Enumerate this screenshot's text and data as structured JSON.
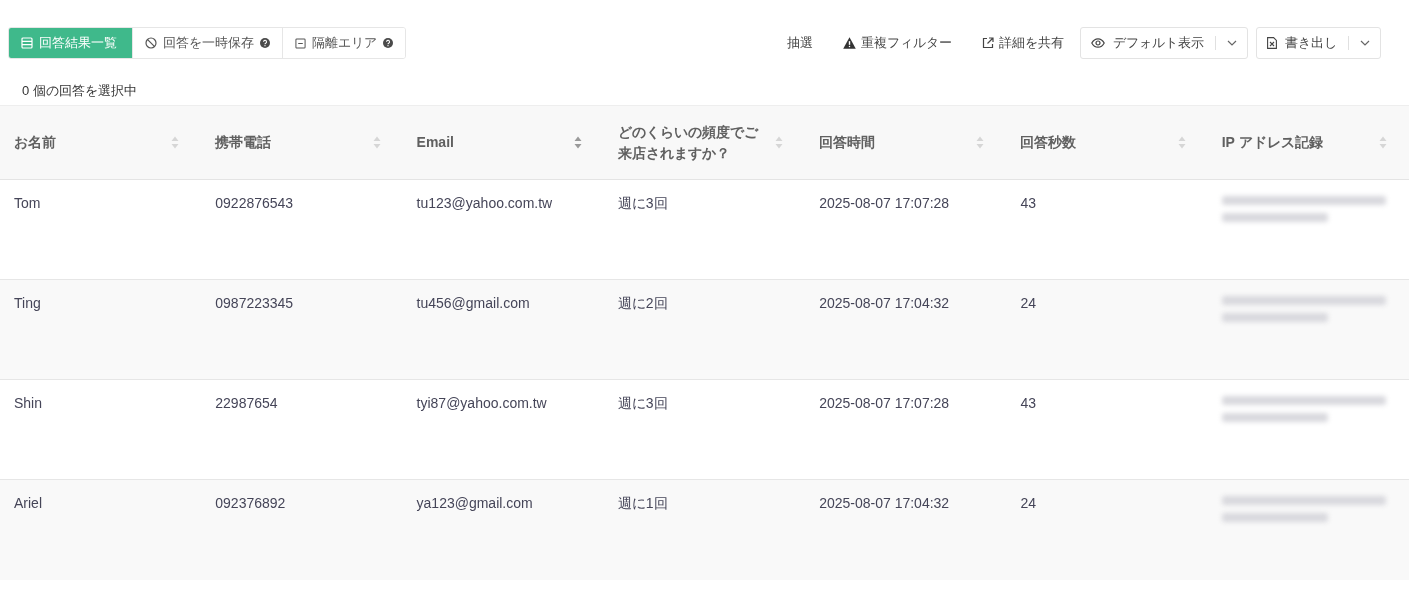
{
  "tabs": [
    {
      "label": "回答結果一覧",
      "selected": true
    },
    {
      "label": "回答を一時保存",
      "selected": false
    },
    {
      "label": "隔離エリア",
      "selected": false
    }
  ],
  "actions": [
    {
      "kind": "link",
      "label": "抽選"
    },
    {
      "kind": "link",
      "label": "重複フィルター"
    },
    {
      "kind": "link",
      "label": "詳細を共有"
    },
    {
      "kind": "dropdown",
      "label": "デフォルト表示"
    },
    {
      "kind": "dropdown",
      "label": "書き出し"
    }
  ],
  "selection_status": "0 個の回答を選択中",
  "table": {
    "columns": [
      {
        "label": "お名前",
        "sort_active": false
      },
      {
        "label": "携帯電話",
        "sort_active": false
      },
      {
        "label": "Email",
        "sort_active": true
      },
      {
        "label": "どのくらいの頻度でご来店されますか？",
        "sort_active": false
      },
      {
        "label": "回答時間",
        "sort_active": false
      },
      {
        "label": "回答秒数",
        "sort_active": false
      },
      {
        "label": "IP アドレス記録",
        "sort_active": false
      }
    ],
    "rows": [
      {
        "cells": [
          "Tom",
          "0922876543",
          "tu123@yahoo.com.tw",
          "週に3回",
          "2025-08-07 17:07:28",
          "43"
        ],
        "ip_blurred": true
      },
      {
        "cells": [
          "Ting",
          "0987223345",
          "tu456@gmail.com",
          "週に2回",
          "2025-08-07 17:04:32",
          "24"
        ],
        "ip_blurred": true
      },
      {
        "cells": [
          "Shin",
          "22987654",
          "tyi87@yahoo.com.tw",
          "週に3回",
          "2025-08-07 17:07:28",
          "43"
        ],
        "ip_blurred": true
      },
      {
        "cells": [
          "Ariel",
          "092376892",
          "ya123@gmail.com",
          "週に1回",
          "2025-08-07 17:04:32",
          "24"
        ],
        "ip_blurred": true
      }
    ]
  }
}
